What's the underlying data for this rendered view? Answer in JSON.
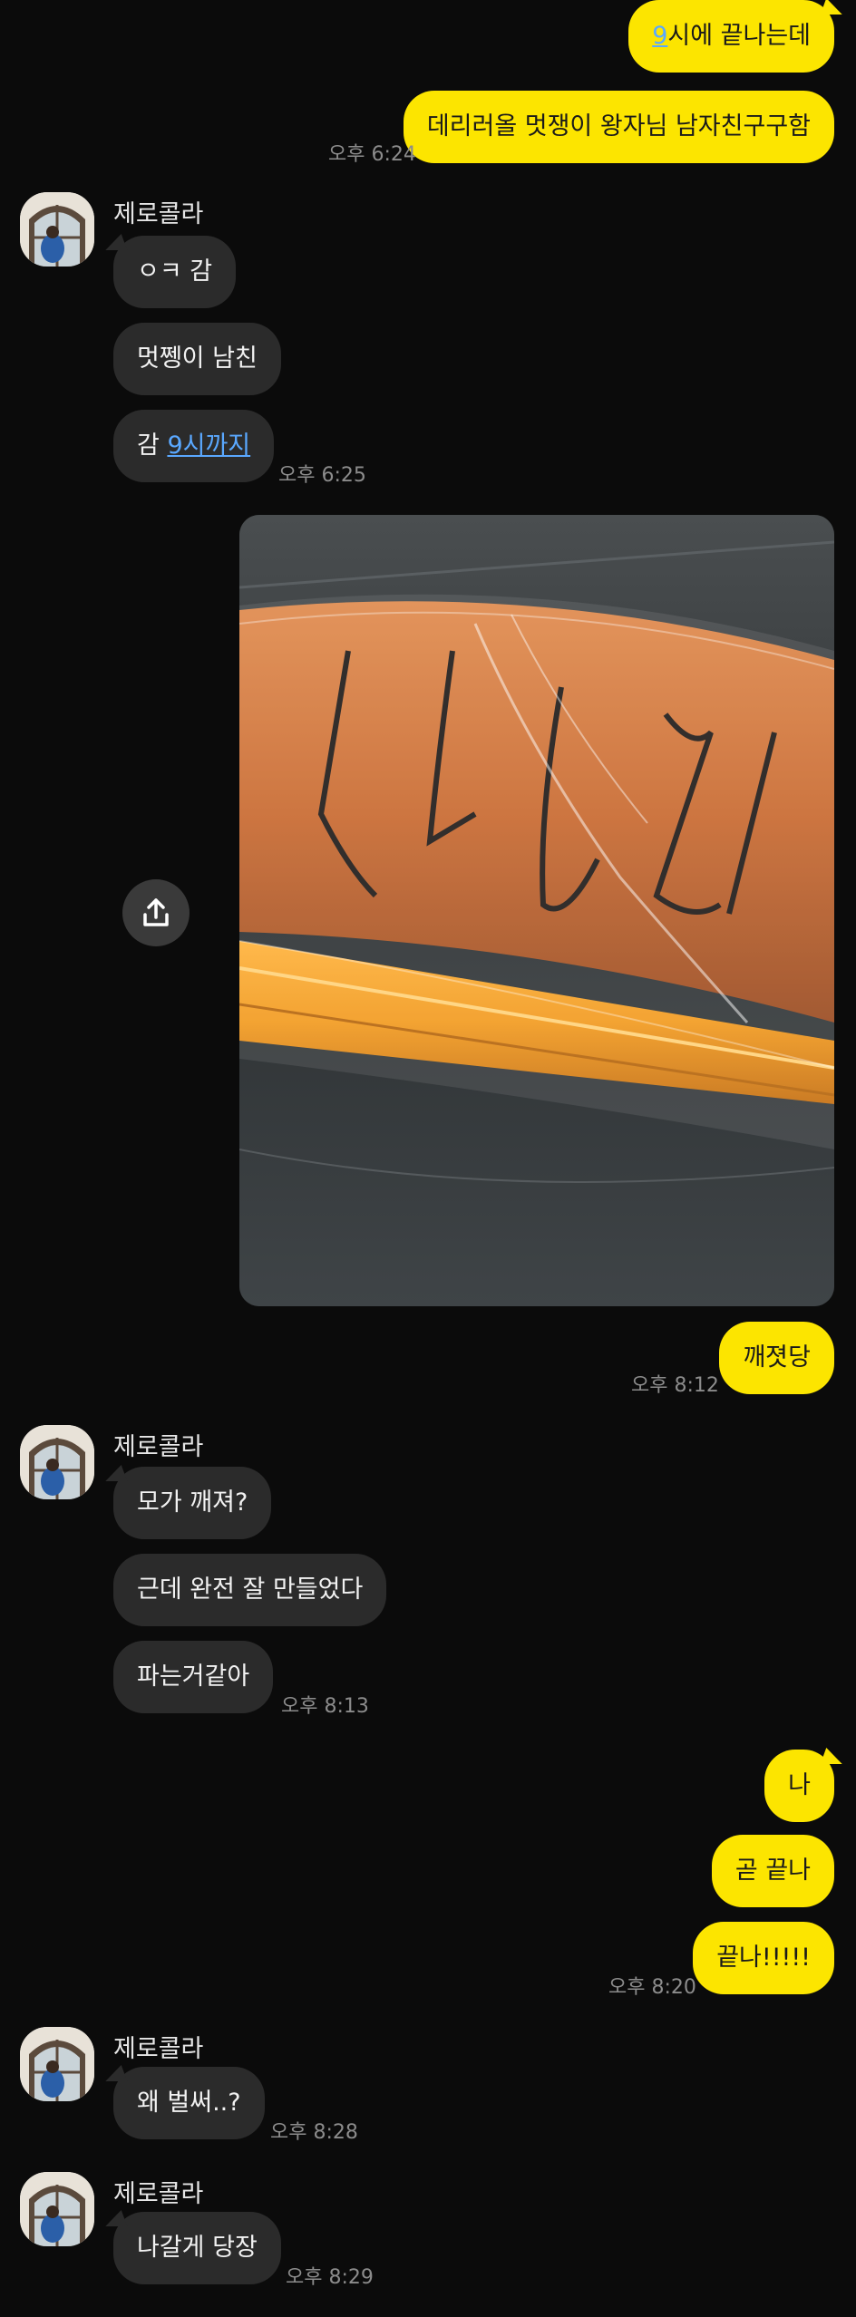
{
  "contact": {
    "name": "제로콜라"
  },
  "messages": {
    "m1_pre": "9",
    "m1_post": "시에 끝나는데",
    "m2": "데리러올 멋쟁이 왕자님 남자친구구함",
    "t1": "오후 6:24",
    "m3": "ㅇㅋ 감",
    "m4": "멋쩽이 남친",
    "m5_pre": "감 ",
    "m5_link": "9시까지",
    "t2": "오후 6:25",
    "m6": "깨졋당",
    "t3": "오후 8:12",
    "m7": "모가 깨져?",
    "m8": "근데 완전 잘 만들었다",
    "m9": "파는거같아",
    "t4": "오후 8:13",
    "m10": "나",
    "m11": "곧 끝나",
    "m12": "끝나!!!!!",
    "t5": "오후 8:20",
    "m13": "왜 벌써..?",
    "t6": "오후 8:28",
    "m14": "나갈게 당장",
    "t7": "오후 8:29"
  },
  "icons": {
    "share": "share-upload-icon",
    "avatar": "profile-photo"
  },
  "colors": {
    "my_bubble": "#fce500",
    "their_bubble": "#2b2b2b",
    "background": "#0b0b0b",
    "link": "#5aa8ff"
  }
}
